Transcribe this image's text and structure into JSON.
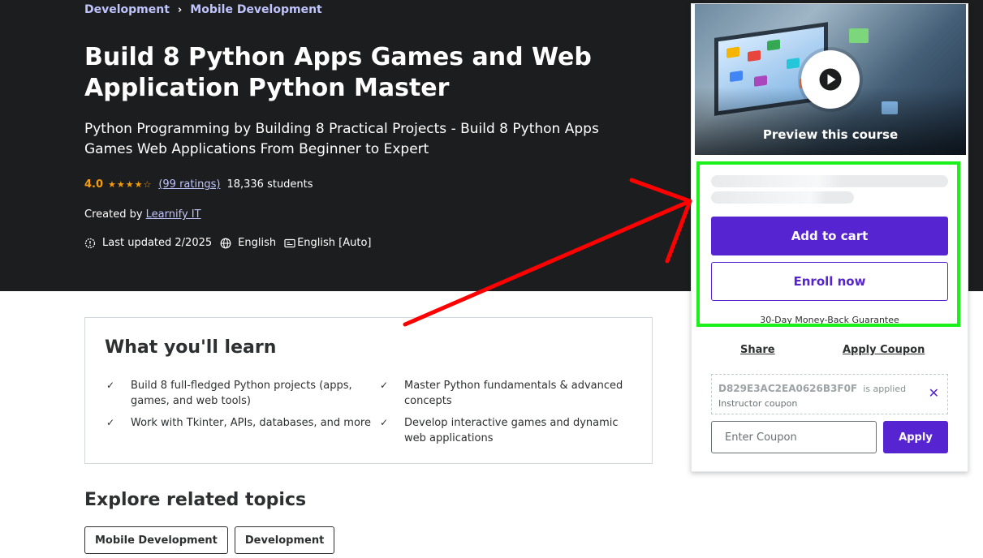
{
  "breadcrumb": [
    {
      "label": "Development"
    },
    {
      "label": "Mobile Development"
    }
  ],
  "course": {
    "title": "Build 8 Python Apps Games and Web Application Python Master",
    "subtitle": "Python Programming by Building 8 Practical Projects - Build 8 Python Apps Games Web Applications From Beginner to Expert",
    "rating": "4.0",
    "ratings_count": "(99 ratings)",
    "students": "18,336 students",
    "created_by_label": "Created by",
    "author": "Learnify IT",
    "last_updated": "Last updated 2/2025",
    "language": "English",
    "captions": "English [Auto]"
  },
  "learn": {
    "title": "What you'll learn",
    "items": [
      "Build 8 full-fledged Python projects (apps, games, and web tools)",
      "Master Python fundamentals & advanced concepts",
      "Work with Tkinter, APIs, databases, and more",
      "Develop interactive games and dynamic web applications"
    ]
  },
  "explore": {
    "title": "Explore related topics",
    "topics": [
      "Mobile Development",
      "Development"
    ]
  },
  "sidebar": {
    "preview_label": "Preview this course",
    "add_to_cart": "Add to cart",
    "enroll_now": "Enroll now",
    "guarantee": "30-Day Money-Back Guarantee",
    "share": "Share",
    "apply_coupon": "Apply Coupon",
    "coupon_code": "D829E3AC2EA0626B3F0F",
    "coupon_applied": "is applied",
    "coupon_type": "Instructor coupon",
    "coupon_placeholder": "Enter Coupon",
    "apply": "Apply"
  },
  "colors": {
    "hero_bg": "#1c1d1f",
    "brand_purple": "#5624d0",
    "link_lavender": "#c0c4fc",
    "star_orange": "#f69c08",
    "highlight_green": "#1bf01b",
    "arrow_red": "#ff0000"
  }
}
